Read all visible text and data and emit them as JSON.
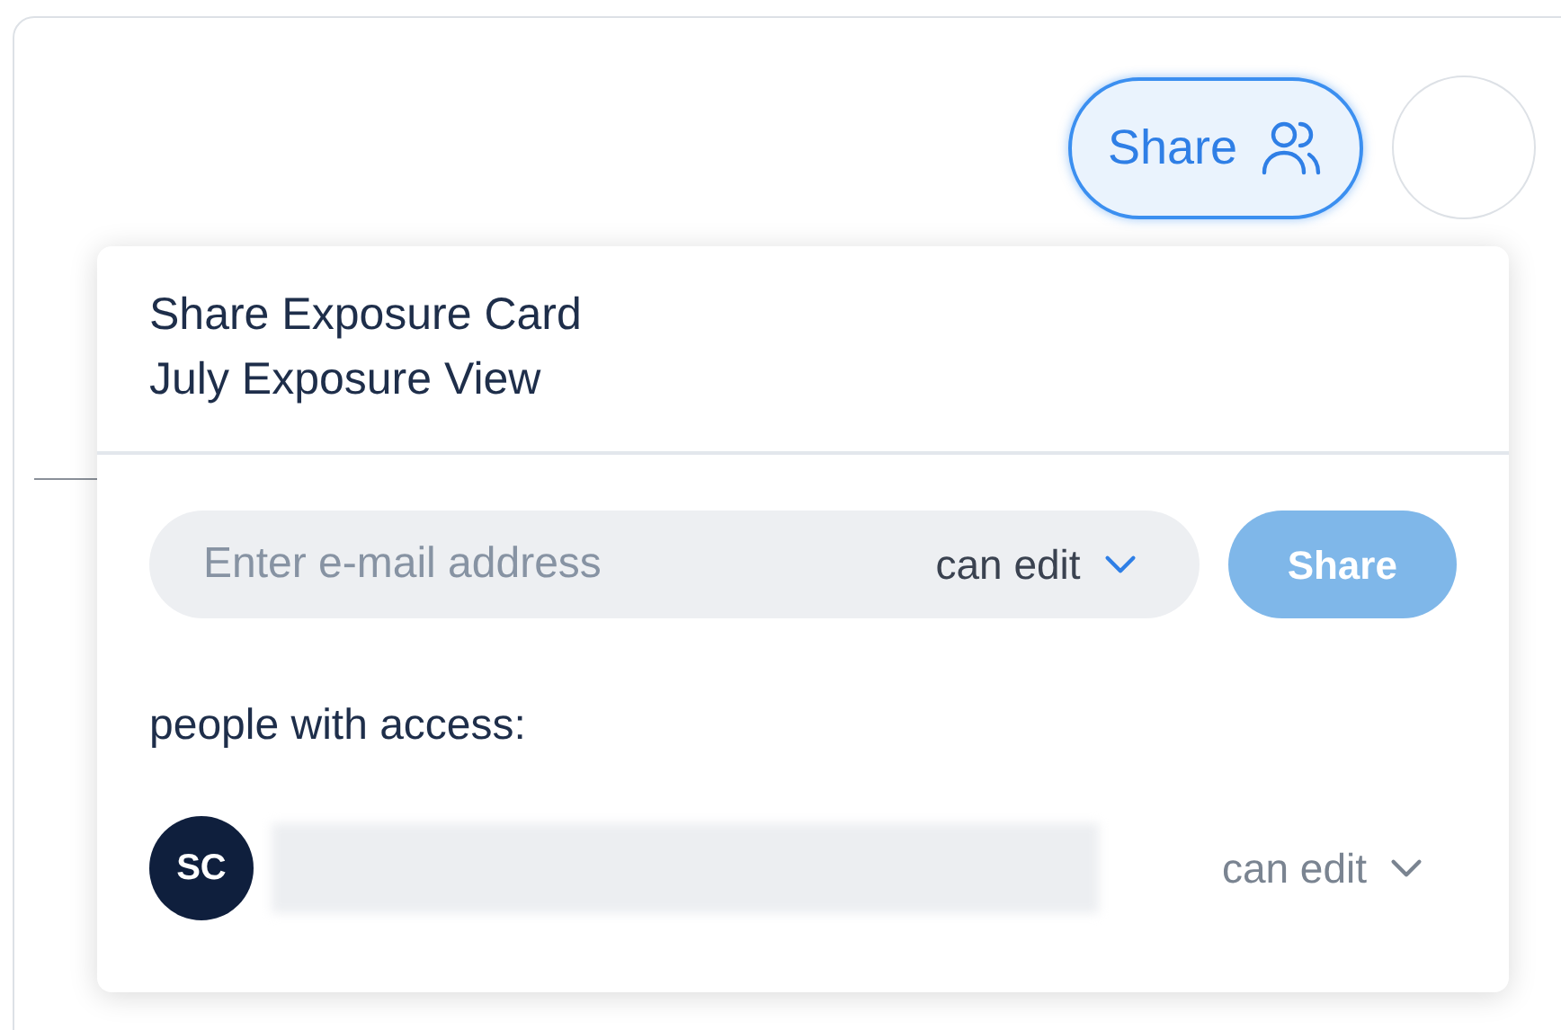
{
  "toolbar": {
    "share_button": "Share"
  },
  "dialog": {
    "title": "Share Exposure Card",
    "subtitle": "July Exposure View",
    "invite": {
      "placeholder": "Enter e-mail address",
      "permission": "can edit",
      "button": "Share",
      "disabled": true
    },
    "access_heading": "people with access:",
    "people": [
      {
        "initials": "SC",
        "permission": "can edit"
      }
    ]
  }
}
